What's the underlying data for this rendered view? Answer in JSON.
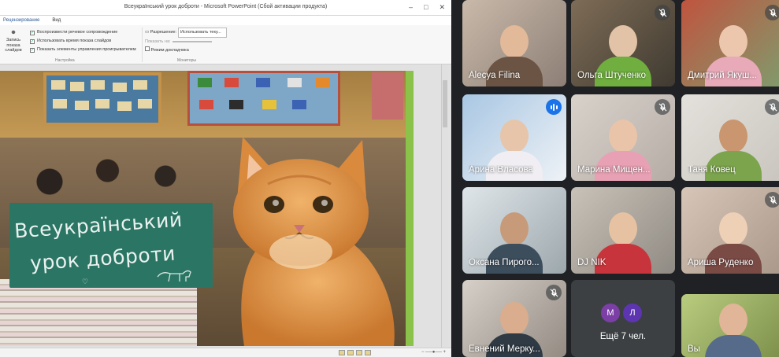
{
  "ppt": {
    "title": "Всеукраїнський урок доброти - Microsoft PowerPoint (Сбой активации продукта)",
    "menu": [
      "Рецензирование",
      "Вид"
    ],
    "ribbon": {
      "record_label": "Запись показа слайдов",
      "options": [
        {
          "label": "Воспроизвести речевое сопровождение",
          "checked": true
        },
        {
          "label": "Использовать время показа слайдов",
          "checked": true
        },
        {
          "label": "Показать элементы управления проигрывателем",
          "checked": true
        }
      ],
      "setup_group": "Настройка",
      "resolution_label": "Разрешение:",
      "resolution_value": "Использовать теку...",
      "show_on_label": "Показать на:",
      "presenter_view_label": "Режим докладчика",
      "monitors_group": "Мониторы"
    },
    "slide": {
      "chalk_line1": "Всеукраїнський",
      "chalk_line2": "урок доброти"
    }
  },
  "meet": {
    "tiles": [
      {
        "name": "Alесya Filina",
        "muted": false,
        "speaking": false
      },
      {
        "name": "Ольга Штученко",
        "muted": true,
        "speaking": false
      },
      {
        "name": "Дмитрий Якуш...",
        "muted": true,
        "speaking": false
      },
      {
        "name": "Арина Власова",
        "muted": false,
        "speaking": true
      },
      {
        "name": "Марина Мищен...",
        "muted": true,
        "speaking": false
      },
      {
        "name": "Таня Ковец",
        "muted": true,
        "speaking": false
      },
      {
        "name": "Оксана Пирого...",
        "muted": false,
        "speaking": false
      },
      {
        "name": "DJ NIK",
        "muted": false,
        "speaking": false
      },
      {
        "name": "Ариша Руденко",
        "muted": true,
        "speaking": false
      },
      {
        "name": "Евнений Мерку...",
        "muted": true,
        "speaking": false
      },
      {
        "name": "Вы",
        "muted": false,
        "speaking": false
      }
    ],
    "more": {
      "avatar1": "М",
      "avatar2": "Л",
      "label": "Ещё 7 чел."
    },
    "colors": {
      "speaking": "#1a73e8",
      "tile_bg": "#3c4043",
      "page_bg": "#202124"
    }
  }
}
